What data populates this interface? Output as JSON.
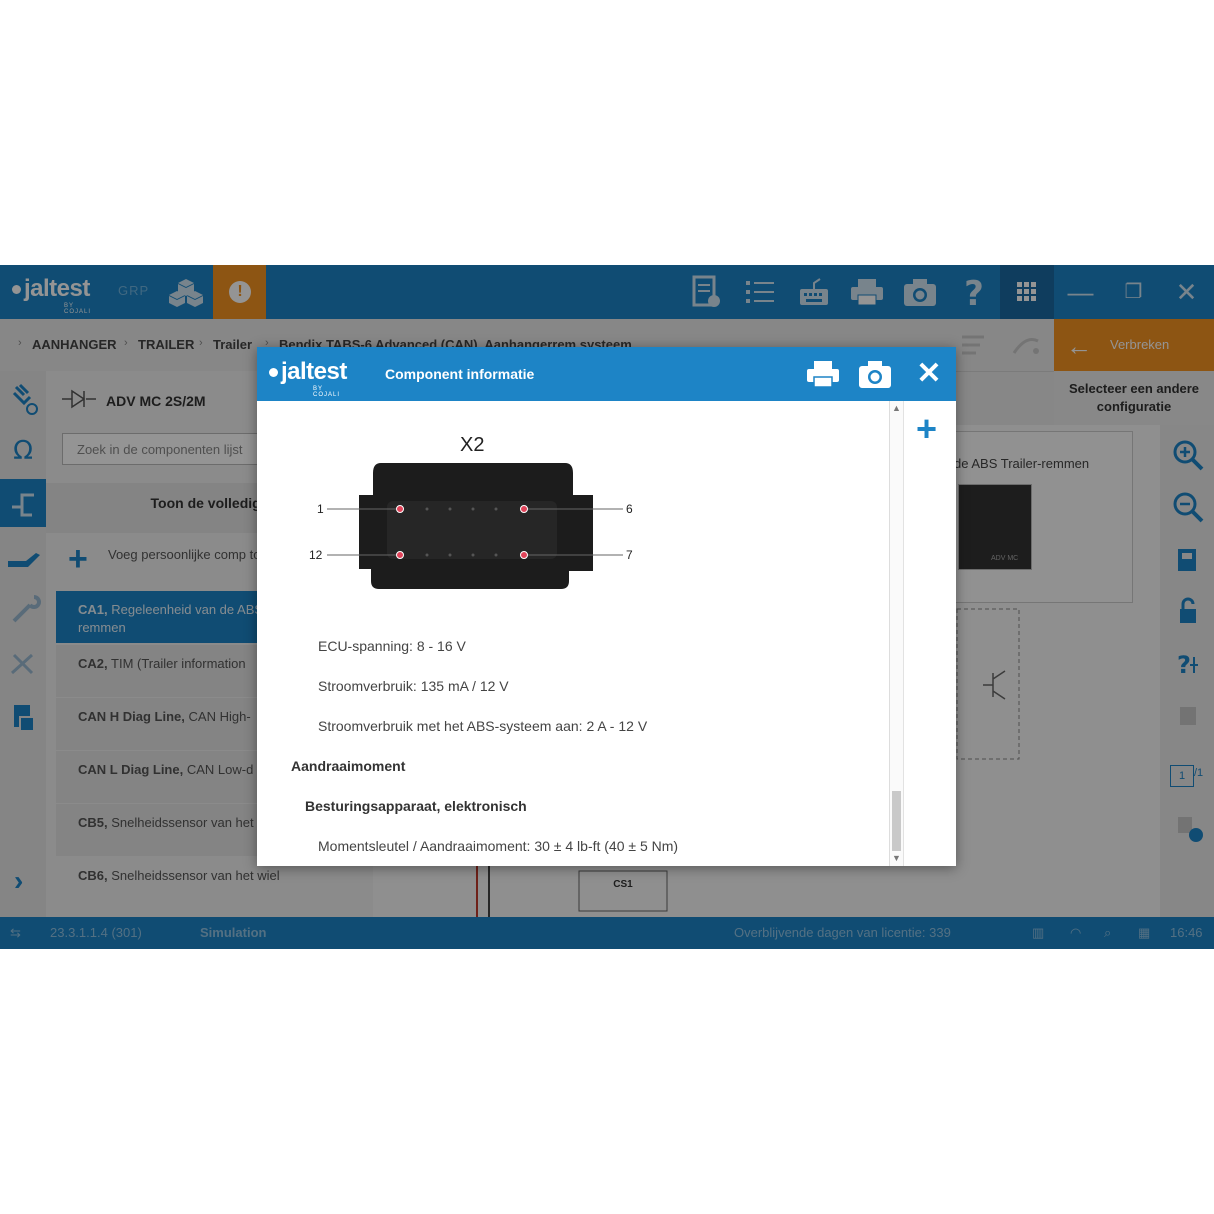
{
  "app": {
    "logo": "jaltest",
    "logo_sub": "BY COJALI",
    "grp": "GRP",
    "warning_glyph": "!"
  },
  "topbar_icons": [
    "report-icon",
    "list-icon",
    "keyboard-icon",
    "print-icon",
    "camera-icon",
    "help-icon"
  ],
  "window": {
    "grid_icon": "grid-icon",
    "minimize": "—",
    "restore": "❐",
    "close": "✕"
  },
  "breadcrumb": [
    "AANHANGER",
    "TRAILER",
    "Trailer",
    "Bendix TABS-6 Advanced (CAN). Aanhangerrem systeem"
  ],
  "disconnect": {
    "label": "Verbreken"
  },
  "select_config": "Selecteer een andere configuratie",
  "list": {
    "header": "ADV MC 2S/2M",
    "search_placeholder": "Zoek in de componenten lijst",
    "full_label": "Toon de volledige",
    "add_label": "Voeg persoonlijke comp toe",
    "items": [
      {
        "code": "CA1,",
        "text": "Regeleenheid van de ABS Trailer-remmen"
      },
      {
        "code": "CA2,",
        "text": "TIM (Trailer information"
      },
      {
        "code": "CAN H Diag Line,",
        "text": "CAN High-"
      },
      {
        "code": "CAN L Diag Line,",
        "text": "CAN Low-d"
      },
      {
        "code": "CB5,",
        "text": "Snelheidssensor van het"
      },
      {
        "code": "CB6,",
        "text": "Snelheidssensor van het wiel"
      }
    ]
  },
  "canvas": {
    "ref_text": "de ABS Trailer-remmen",
    "adv_label": "ADV MC",
    "cs1": "CS1"
  },
  "pager": {
    "current": "1",
    "total": "/1"
  },
  "status": {
    "version": "23.3.1.1.4 (301)",
    "mode": "Simulation",
    "license": "Overblijvende dagen van licentie: 339",
    "time": "16:46"
  },
  "modal": {
    "logo": "jaltest",
    "logo_sub": "BY COJALI",
    "title": "Component informatie",
    "connector_title": "X2",
    "pins": {
      "top_left": "1",
      "top_right": "6",
      "bottom_left": "12",
      "bottom_right": "7"
    },
    "lines": [
      "ECU-spanning: 8 - 16 V",
      "Stroomverbruik: 135 mA / 12 V",
      "Stroomverbruik met het ABS-systeem aan: 2 A - 12 V"
    ],
    "heading": "Aandraaimoment",
    "subheading": "Besturingsapparaat, elektronisch",
    "torque": "Momentsleutel / Aandraaimoment: 30 ± 4 lb-ft (40 ± 5 Nm)"
  },
  "colors": {
    "primary": "#1d84c6",
    "accent": "#f39321",
    "pin": "#e0445a"
  }
}
